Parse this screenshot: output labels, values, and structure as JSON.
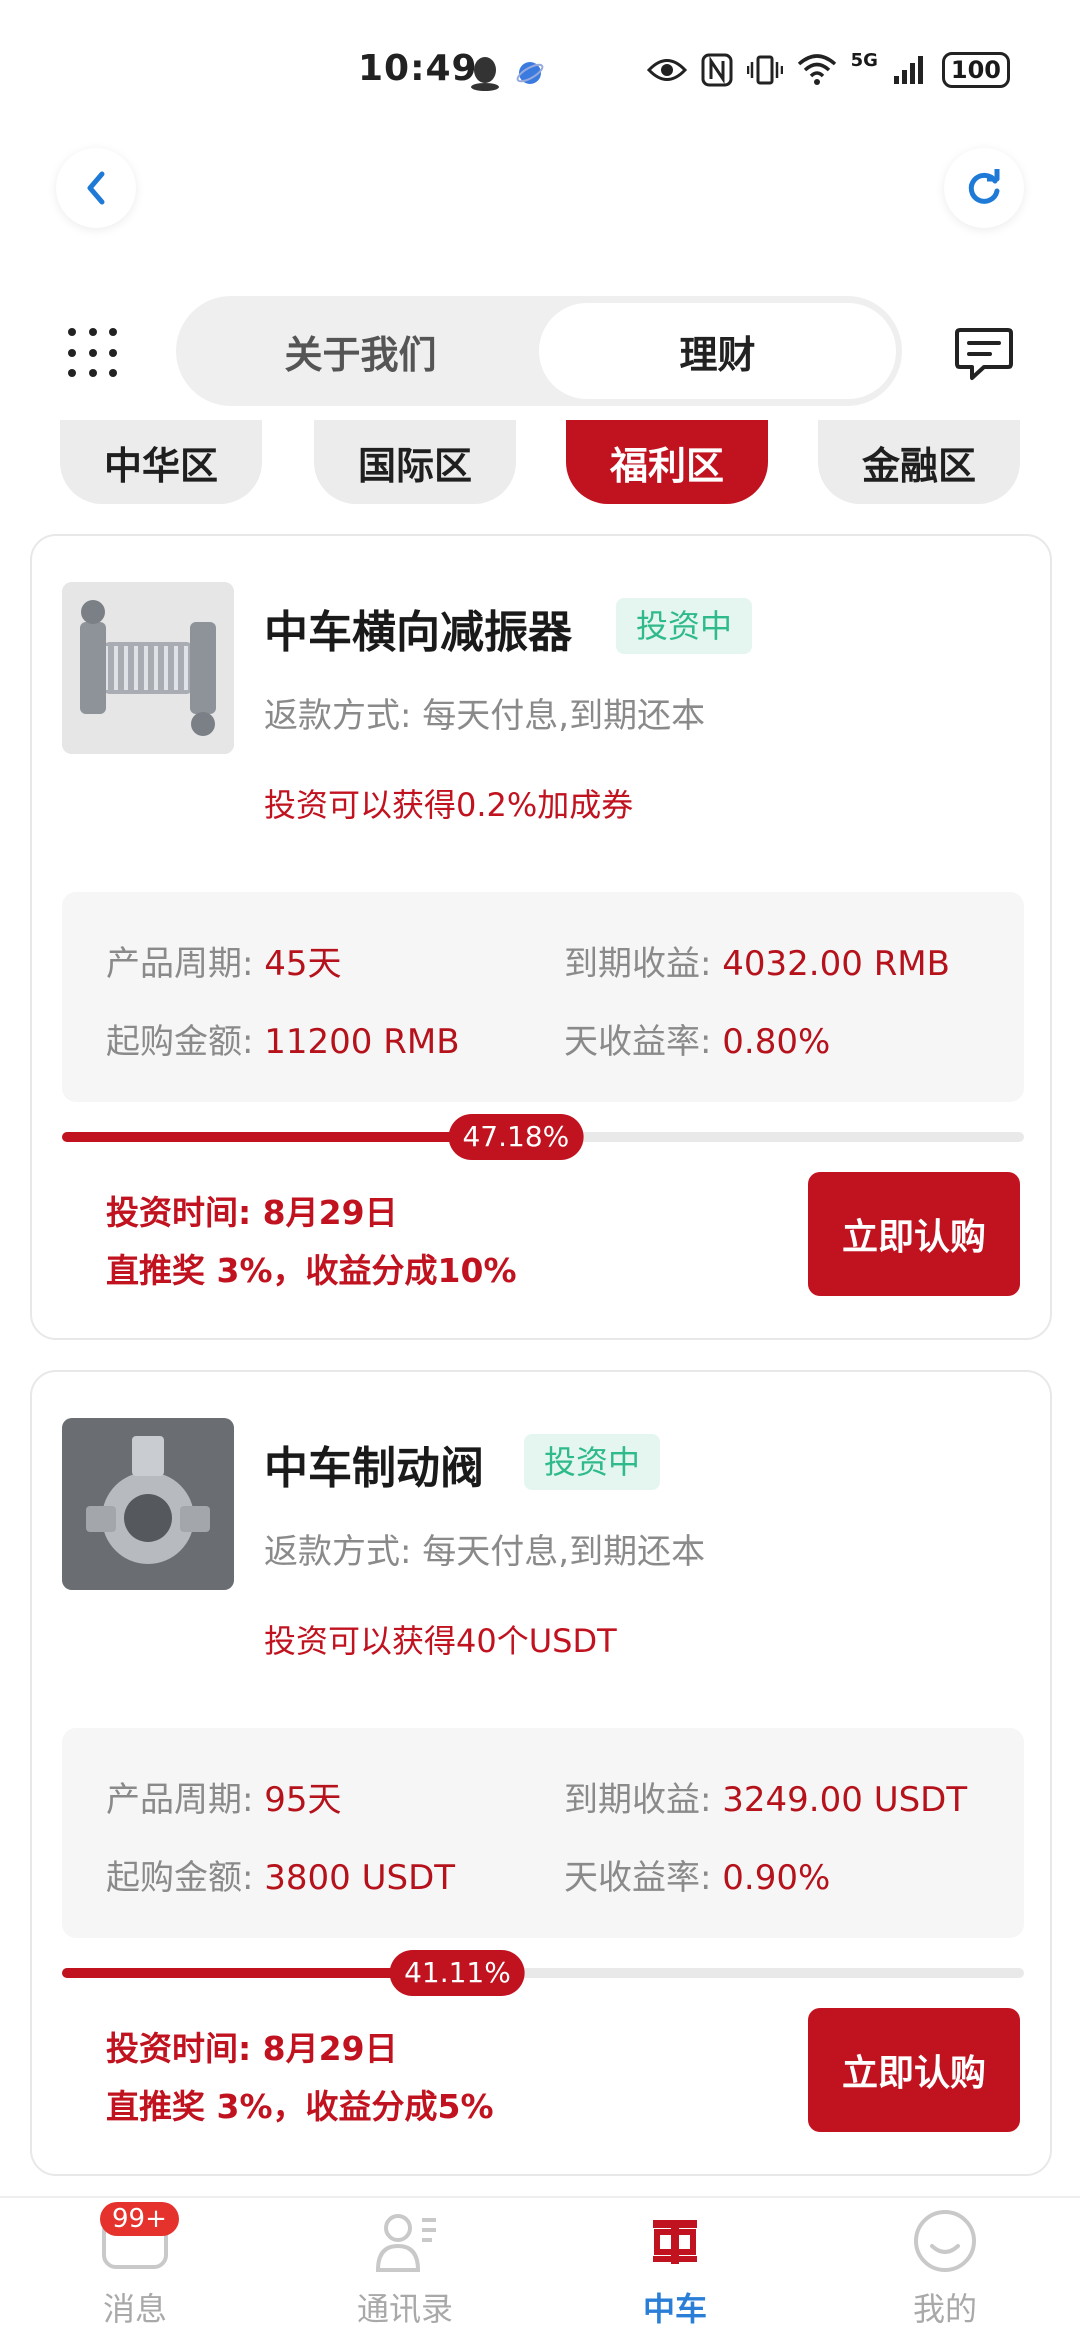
{
  "status_bar": {
    "time": "10:49",
    "network": "5G",
    "battery": "100"
  },
  "segmented": {
    "tabs": [
      "关于我们",
      "理财"
    ],
    "active_index": 1
  },
  "zones": [
    "中华区",
    "国际区",
    "福利区",
    "金融区"
  ],
  "active_zone": "福利区",
  "products": [
    {
      "name": "中车横向减振器",
      "status": "投资中",
      "repay": "返款方式: 每天付息,到期还本",
      "bonus": "投资可以获得0.2%加成券",
      "cycle_label": "产品周期:",
      "cycle_value": "45天",
      "return_label": "到期收益:",
      "return_value": "4032.00 RMB",
      "min_label": "起购金额:",
      "min_value": "11200 RMB",
      "rate_label": "天收益率:",
      "rate_value": "0.80%",
      "progress_text": "47.18%",
      "progress": 47.18,
      "invest_time": "投资时间: 8月29日",
      "reward": "直推奖 3%，收益分成10%",
      "buy_label": "立即认购"
    },
    {
      "name": "中车制动阀",
      "status": "投资中",
      "repay": "返款方式: 每天付息,到期还本",
      "bonus": "投资可以获得40个USDT",
      "cycle_label": "产品周期:",
      "cycle_value": "95天",
      "return_label": "到期收益:",
      "return_value": "3249.00 USDT",
      "min_label": "起购金额:",
      "min_value": "3800 USDT",
      "rate_label": "天收益率:",
      "rate_value": "0.90%",
      "progress_text": "41.11%",
      "progress": 41.11,
      "invest_time": "投资时间: 8月29日",
      "reward": "直推奖 3%，收益分成5%",
      "buy_label": "立即认购"
    }
  ],
  "bottom_nav": [
    {
      "label": "消息",
      "icon": "message-icon",
      "badge": "99+"
    },
    {
      "label": "通讯录",
      "icon": "contacts-icon"
    },
    {
      "label": "中车",
      "icon": "crrc-logo-icon",
      "active": true
    },
    {
      "label": "我的",
      "icon": "profile-icon"
    }
  ],
  "colors": {
    "accent": "#c1121f",
    "badge_green": "#2fba8a",
    "nav_active": "#2a7ed8"
  }
}
